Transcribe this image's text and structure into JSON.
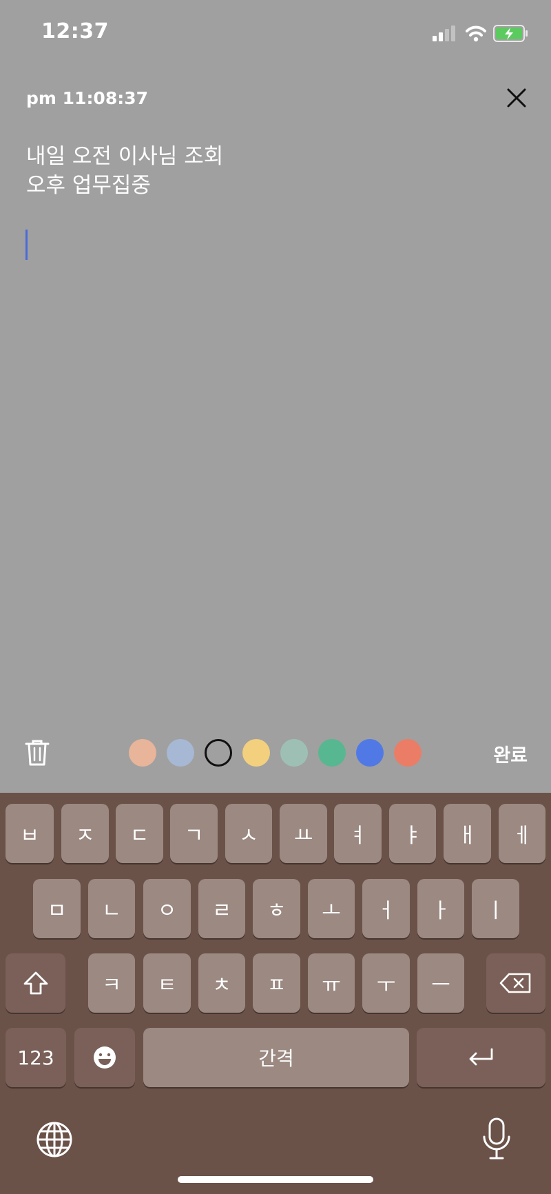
{
  "status_bar": {
    "time": "12:37",
    "icons": [
      "signal-icon",
      "wifi-icon",
      "battery-charging-icon"
    ]
  },
  "note": {
    "timestamp": "pm 11:08:37",
    "text": "내일 오전 이사님 조회\n오후 업무집중",
    "close_icon": "close-icon"
  },
  "toolbar": {
    "delete_icon": "trash-icon",
    "colors": [
      {
        "name": "peach",
        "hex": "#e8b49a",
        "selected": false
      },
      {
        "name": "light-blue",
        "hex": "#a7b8d4",
        "selected": false
      },
      {
        "name": "none",
        "hex": "transparent",
        "selected": true
      },
      {
        "name": "yellow",
        "hex": "#f2d07e",
        "selected": false
      },
      {
        "name": "sage",
        "hex": "#9ec0b4",
        "selected": false
      },
      {
        "name": "green",
        "hex": "#57b790",
        "selected": false
      },
      {
        "name": "blue",
        "hex": "#5179e6",
        "selected": false
      },
      {
        "name": "coral",
        "hex": "#eb7d66",
        "selected": false
      }
    ],
    "done_label": "완료"
  },
  "keyboard": {
    "row1": [
      "ㅂ",
      "ㅈ",
      "ㄷ",
      "ㄱ",
      "ㅅ",
      "ㅛ",
      "ㅕ",
      "ㅑ",
      "ㅐ",
      "ㅔ"
    ],
    "row2": [
      "ㅁ",
      "ㄴ",
      "ㅇ",
      "ㄹ",
      "ㅎ",
      "ㅗ",
      "ㅓ",
      "ㅏ",
      "ㅣ"
    ],
    "row3": [
      "ㅋ",
      "ㅌ",
      "ㅊ",
      "ㅍ",
      "ㅠ",
      "ㅜ",
      "ㅡ"
    ],
    "shift_icon": "shift-icon",
    "backspace_icon": "backspace-icon",
    "numbers_label": "123",
    "emoji_icon": "emoji-icon",
    "space_label": "간격",
    "return_icon": "return-icon",
    "globe_icon": "globe-icon",
    "mic_icon": "microphone-icon"
  },
  "colors": {
    "background": "#a0a0a0",
    "keyboard_bg": "#6b5249",
    "key_light": "#9b8982",
    "key_dark": "#7a6058",
    "caret": "#4a6ad8"
  }
}
